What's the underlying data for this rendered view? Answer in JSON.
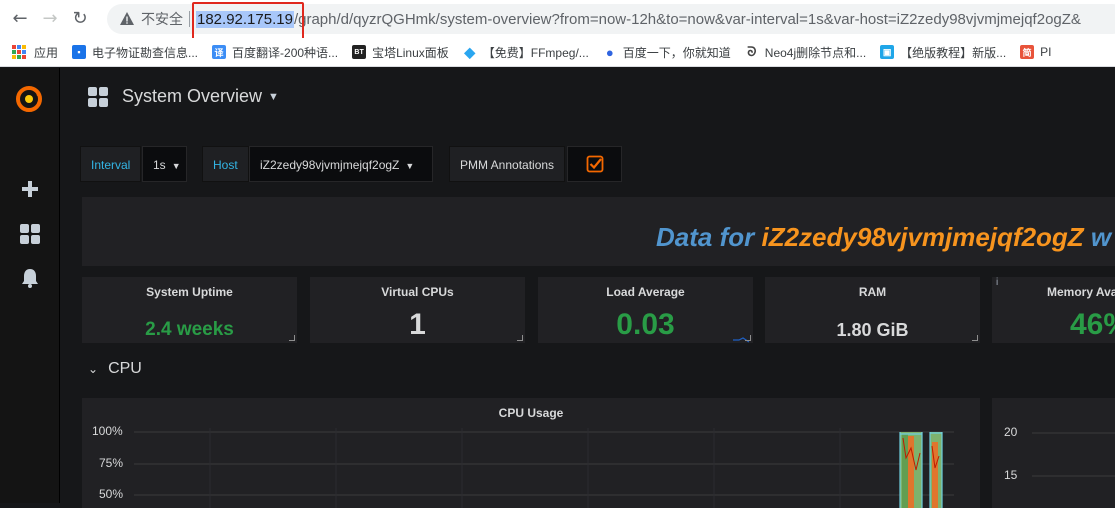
{
  "browser": {
    "insecure_label": "不安全",
    "url_host": "182.92.175.19",
    "url_rest": "/graph/d/qyzrQGHmk/system-overview?from=now-12h&to=now&var-interval=1s&var-host=iZ2zedy98vjvmjmejqf2ogZ&",
    "bookmarks": [
      {
        "label": "应用",
        "icon": "apps-icon"
      },
      {
        "label": "电子物证勘查信息...",
        "icon": "document-icon",
        "color": "#1a73e8"
      },
      {
        "label": "百度翻译-200种语...",
        "icon": "translate-icon",
        "color": "#3c8df5",
        "glyph": "译"
      },
      {
        "label": "宝塔Linux面板",
        "icon": "bt-icon",
        "color": "#222222",
        "glyph": "BT"
      },
      {
        "label": "【免费】FFmpeg/...",
        "icon": "diamond-icon",
        "color": "#2aa6f0"
      },
      {
        "label": "百度一下，你就知道",
        "icon": "paw-icon",
        "color": "#2f64e0"
      },
      {
        "label": "Neo4j删除节点和...",
        "icon": "swirl-icon",
        "color": "#444444"
      },
      {
        "label": "【绝版教程】新版...",
        "icon": "tv-icon",
        "color": "#1fa6e8"
      },
      {
        "label": "PI",
        "icon": "jian-icon",
        "color": "#e8533a",
        "glyph": "简"
      }
    ]
  },
  "dashboard": {
    "title": "System Overview",
    "variables": {
      "interval_label": "Interval",
      "interval_value": "1s",
      "host_label": "Host",
      "host_value": "iZ2zedy98vjvmjmejqf2ogZ",
      "pmm_label": "PMM Annotations",
      "pmm_checked": true
    },
    "banner": {
      "prefix": "Data for ",
      "host": "iZ2zedy98vjvmjmejqf2ogZ",
      "suffix": " w"
    },
    "stats": [
      {
        "title": "System Uptime",
        "value": "2.4 weeks",
        "color": "#299c46"
      },
      {
        "title": "Virtual CPUs",
        "value": "1",
        "color": "#d8d9da"
      },
      {
        "title": "Load Average",
        "value": "0.03",
        "color": "#299c46"
      },
      {
        "title": "RAM",
        "value": "1.80 GiB",
        "color": "#d8d9da"
      },
      {
        "title": "Memory Ava",
        "value": "46%",
        "color": "#299c46"
      }
    ],
    "row_title": "CPU",
    "cpu_panel": {
      "title": "CPU Usage",
      "y_ticks": [
        "100%",
        "75%",
        "50%"
      ]
    },
    "right_panel": {
      "y_ticks": [
        "20",
        "15"
      ]
    }
  }
}
